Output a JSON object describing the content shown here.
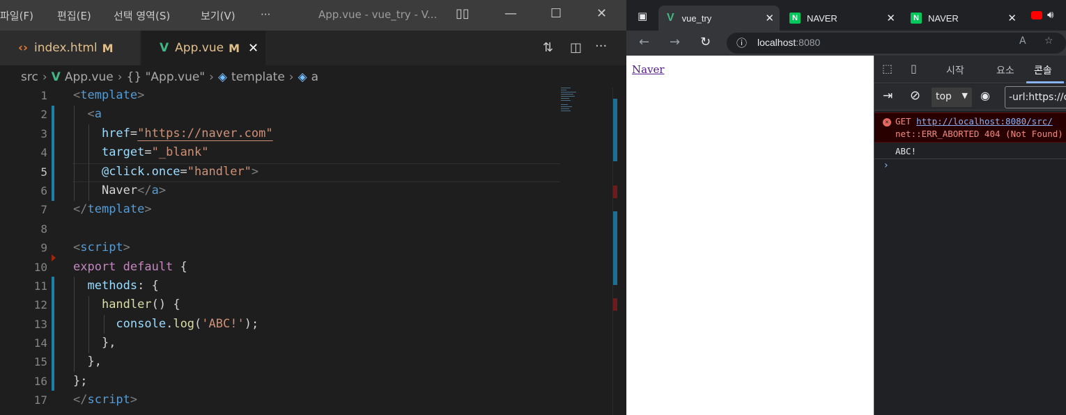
{
  "vscode": {
    "menu": [
      "파일(F)",
      "편집(E)",
      "선택 영역(S)",
      "보기(V)",
      "···"
    ],
    "window_title": "App.vue - vue_try - V...",
    "tabs": [
      {
        "label": "index.html",
        "badge": "M",
        "icon": "html-icon"
      },
      {
        "label": "App.vue",
        "badge": "M",
        "icon": "vue-icon",
        "close": "✕"
      }
    ],
    "breadcrumb": [
      "src",
      "App.vue",
      "{} \"App.vue\"",
      "template",
      "a"
    ],
    "line_numbers": [
      "1",
      "2",
      "3",
      "4",
      "5",
      "6",
      "7",
      "8",
      "9",
      "10",
      "11",
      "12",
      "13",
      "14",
      "15",
      "16",
      "17"
    ],
    "code": {
      "l1_open": "<",
      "l1_tag": "template",
      "l1_close": ">",
      "l2_open": "<",
      "l2_tag": "a",
      "l3_attr": "href",
      "l3_eq": "=",
      "l3_val": "\"https://naver.com\"",
      "l4_attr": "target",
      "l4_eq": "=",
      "l4_val": "\"_blank\"",
      "l5_attr": "@click.once",
      "l5_eq": "=",
      "l5_val": "\"handler\"",
      "l5_close": ">",
      "l6_text": "Naver",
      "l6_open": "</",
      "l6_tag": "a",
      "l6_close": ">",
      "l7_open": "</",
      "l7_tag": "template",
      "l7_close": ">",
      "l9_open": "<",
      "l9_tag": "script",
      "l9_close": ">",
      "l10_kw": "export default",
      "l10_rest": " {",
      "l11_prop": "methods",
      "l11_rest": ": {",
      "l12_fn": "handler",
      "l12_rest": "() {",
      "l13_obj": "console",
      "l13_dot": ".",
      "l13_fn": "log",
      "l13_p1": "(",
      "l13_str": "'ABC!'",
      "l13_p2": ");",
      "l14": "},",
      "l15": "},",
      "l16": "};",
      "l17_open": "</",
      "l17_tag": "script",
      "l17_close": ">"
    }
  },
  "browser": {
    "tabs": [
      {
        "label": "vue_try"
      },
      {
        "label": "NAVER"
      },
      {
        "label": "NAVER"
      }
    ],
    "tab_close": "✕",
    "url_host": "localhost",
    "url_port": ":8080",
    "page_link": "Naver",
    "devtools": {
      "tabs": [
        "시작",
        "요소",
        "콘솔"
      ],
      "context": "top",
      "filter": "-url:https://c",
      "error_prefix": "GET ",
      "error_url": "http://localhost:8080/src/",
      "error_detail": "net::ERR_ABORTED 404 (Not Found)",
      "log": "ABC!",
      "prompt": "›"
    }
  },
  "colors": {
    "vue_green": "#41b883",
    "tag_blue": "#569cd6",
    "string_orange": "#ce9178",
    "keyword_purple": "#c586c0",
    "devtools_active": "#8ab4f8"
  }
}
